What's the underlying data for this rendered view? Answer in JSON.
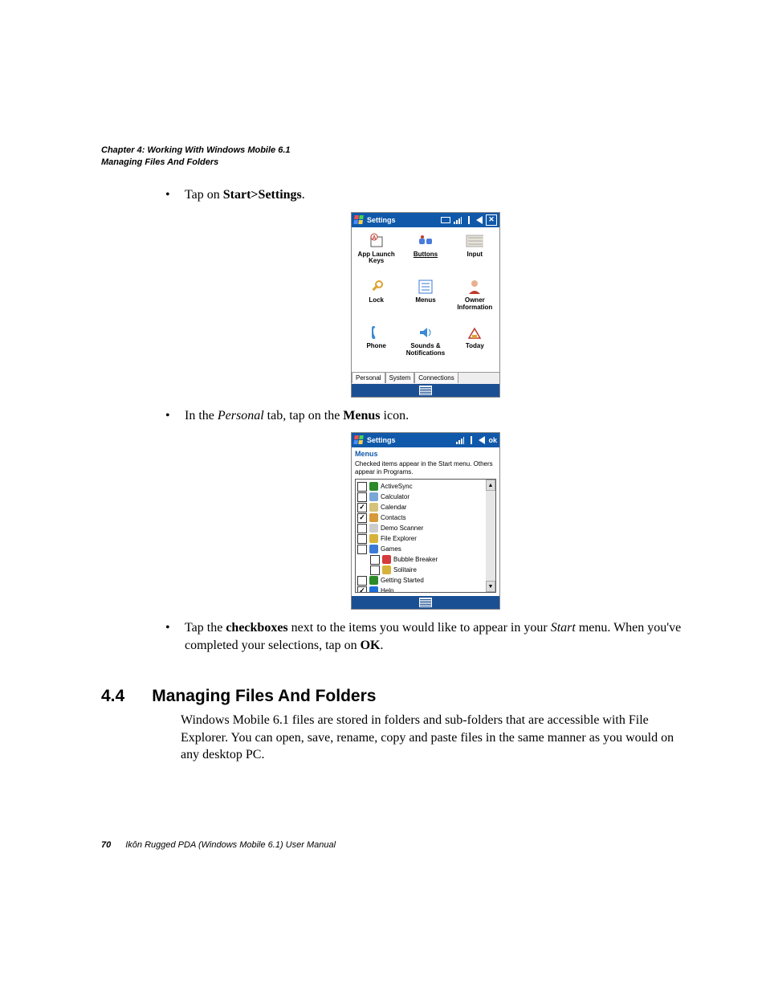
{
  "header": {
    "chapter": "Chapter 4:  Working With Windows Mobile 6.1",
    "section": "Managing Files And Folders"
  },
  "bullets": {
    "b1_pre": "Tap on ",
    "b1_bold": "Start>Settings",
    "b1_post": ".",
    "b2_pre": "In the ",
    "b2_it": "Personal",
    "b2_mid": " tab, tap on the ",
    "b2_bold": "Menus",
    "b2_post": " icon.",
    "b3_pre": "Tap the ",
    "b3_bold1": "checkboxes",
    "b3_mid": " next to the items you would like to appear in your ",
    "b3_it": "Start",
    "b3_mid2": " menu. When you've completed your selections, tap on ",
    "b3_bold2": "OK",
    "b3_post": "."
  },
  "shot1": {
    "title": "Settings",
    "close": "✕",
    "items": [
      "App Launch Keys",
      "Buttons",
      "Input",
      "Lock",
      "Menus",
      "Owner Information",
      "Phone",
      "Sounds & Notifications",
      "Today"
    ],
    "tabs": [
      "Personal",
      "System",
      "Connections"
    ]
  },
  "shot2": {
    "title": "Settings",
    "ok": "ok",
    "subtitle": "Menus",
    "hint": "Checked items appear in the Start menu. Others appear in Programs.",
    "items": [
      {
        "label": "ActiveSync",
        "checked": false,
        "color": "#2a8a2a"
      },
      {
        "label": "Calculator",
        "checked": false,
        "color": "#7aa7d6"
      },
      {
        "label": "Calendar",
        "checked": true,
        "color": "#d6c27a"
      },
      {
        "label": "Contacts",
        "checked": true,
        "color": "#d69a3a"
      },
      {
        "label": "Demo Scanner",
        "checked": false,
        "color": "#ccc"
      },
      {
        "label": "File Explorer",
        "checked": false,
        "color": "#d6b23a"
      },
      {
        "label": "Games",
        "checked": false,
        "color": "#3a7ad6"
      },
      {
        "label": "Bubble Breaker",
        "checked": false,
        "color": "#d63a3a",
        "indent": true
      },
      {
        "label": "Solitaire",
        "checked": false,
        "color": "#d6b23a",
        "indent": true
      },
      {
        "label": "Getting Started",
        "checked": false,
        "color": "#2a8a2a"
      },
      {
        "label": "Help",
        "checked": true,
        "color": "#1a6ed6"
      }
    ]
  },
  "section": {
    "num": "4.4",
    "title": "Managing Files And Folders",
    "body": "Windows Mobile 6.1 files are stored in folders and sub-folders that are accessible with File Explorer. You can open, save, rename, copy and paste files in the same manner as you would on any desktop PC."
  },
  "footer": {
    "page": "70",
    "title": "Ikôn Rugged PDA (Windows Mobile 6.1) User Manual"
  }
}
